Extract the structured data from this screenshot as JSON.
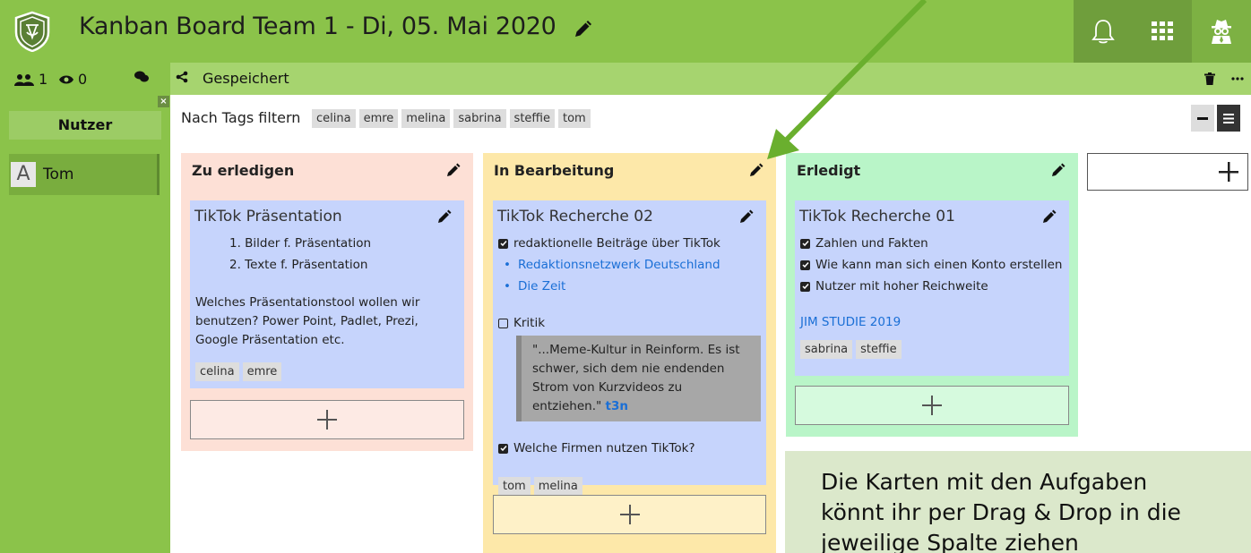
{
  "header": {
    "title": "Kanban Board Team 1 - Di, 05. Mai 2020",
    "icons": [
      "shield-logo",
      "pencil-icon",
      "bell-icon",
      "grid-icon",
      "spy-icon"
    ]
  },
  "subbar": {
    "users_count": "1",
    "viewers_count": "0",
    "saved_label": "Gespeichert"
  },
  "sidebar": {
    "close": "×",
    "users_button": "Nutzer",
    "users": [
      {
        "initial": "A",
        "name": "Tom"
      }
    ]
  },
  "filter": {
    "label": "Nach Tags filtern",
    "tags": [
      "celina",
      "emre",
      "melina",
      "sabrina",
      "steffie",
      "tom"
    ]
  },
  "columns": [
    {
      "title": "Zu erledigen",
      "color": "#fde0d6",
      "add_color": "#fdeae4",
      "card": {
        "title": "TikTok Präsentation",
        "list": [
          "1. Bilder f. Präsentation",
          "2. Texte f. Präsentation"
        ],
        "text": "Welches Präsentationstool wollen wir benutzen? Power Point, Padlet, Prezi, Google Präsentation etc.",
        "tags": [
          "celina",
          "emre"
        ]
      }
    },
    {
      "title": "In Bearbeitung",
      "color": "#fde8a9",
      "add_color": "#fef1c8",
      "card": {
        "title": "TikTok Recherche 02",
        "check1": "redaktionelle Beiträge über TikTok",
        "link1": "Redaktionsnetzwerk Deutschland",
        "link2": "Die Zeit",
        "check2": "Kritik",
        "quote": "\"...Meme-Kultur in Reinform. Es ist schwer, sich dem nie endenden Strom von Kurzvideos zu entziehen.\"",
        "quote_source": "t3n",
        "check3": "Welche Firmen nutzen TikTok?",
        "tags": [
          "tom",
          "melina"
        ]
      }
    },
    {
      "title": "Erledigt",
      "color": "#b9f5c8",
      "add_color": "#d6fade",
      "card": {
        "title": "TikTok Recherche 01",
        "checks": [
          "Zahlen und Fakten",
          "Wie kann man sich einen Konto erstellen",
          "Nutzer mit hoher Reichweite"
        ],
        "link": "JIM STUDIE 2019",
        "tags": [
          "sabrina",
          "steffie"
        ]
      }
    }
  ],
  "add_column": "+",
  "tooltip": "Die Karten mit den Aufgaben könnt ihr per Drag & Drop in die jeweilige Spalte ziehen",
  "colors": {
    "green": "#8bc34a",
    "arrow": "#6aaf2e",
    "card": "#c6d4fc"
  }
}
